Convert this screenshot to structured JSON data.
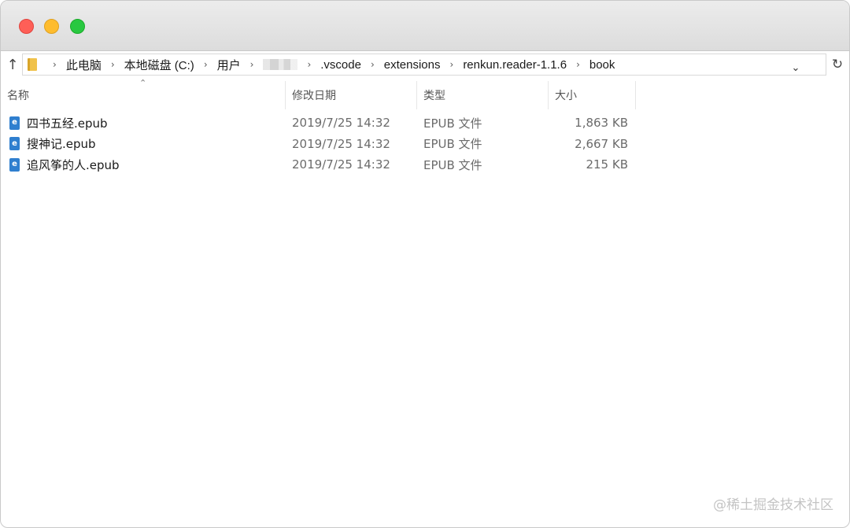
{
  "window": {
    "traffic_lights": [
      "close",
      "minimize",
      "maximize"
    ]
  },
  "address": {
    "crumbs": [
      {
        "label": "此电脑"
      },
      {
        "label": "本地磁盘 (C:)"
      },
      {
        "label": "用户"
      },
      {
        "label": ""
      },
      {
        "label": ".vscode"
      },
      {
        "label": "extensions"
      },
      {
        "label": "renkun.reader-1.1.6"
      },
      {
        "label": "book"
      }
    ]
  },
  "columns": {
    "name": "名称",
    "date": "修改日期",
    "type": "类型",
    "size": "大小"
  },
  "files": [
    {
      "name": "四书五经.epub",
      "date": "2019/7/25 14:32",
      "type": "EPUB 文件",
      "size": "1,863 KB"
    },
    {
      "name": "搜神记.epub",
      "date": "2019/7/25 14:32",
      "type": "EPUB 文件",
      "size": "2,667 KB"
    },
    {
      "name": "追风筝的人.epub",
      "date": "2019/7/25 14:32",
      "type": "EPUB 文件",
      "size": "215 KB"
    }
  ],
  "icons": {
    "up": "arrow-up-icon",
    "folder": "folder-icon",
    "dropdown": "chevron-down-icon",
    "refresh": "refresh-icon",
    "file": "epub-file-icon"
  },
  "watermark": "@稀土掘金技术社区"
}
